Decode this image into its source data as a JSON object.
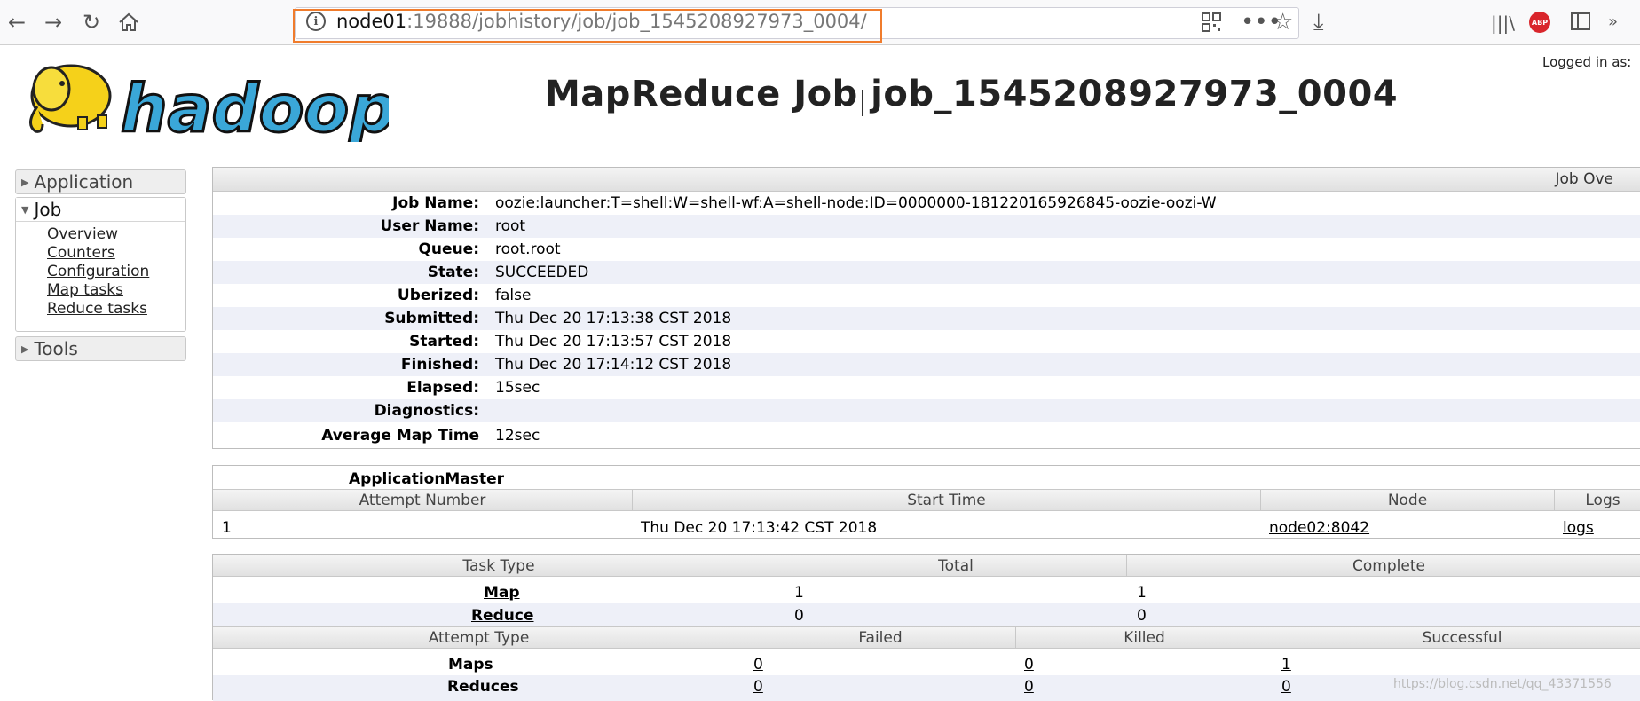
{
  "browser": {
    "url_host": "node01",
    "url_path": ":19888/jobhistory/job/job_1545208927973_0004/"
  },
  "header": {
    "logo_text": "hadoop",
    "title": "MapReduce Job job_1545208927973_0004",
    "logged_in": "Logged in as:"
  },
  "nav": {
    "application": "Application",
    "job": "Job",
    "job_links": [
      "Overview",
      "Counters",
      "Configuration",
      "Map tasks",
      "Reduce tasks"
    ],
    "tools": "Tools"
  },
  "overview": {
    "heading": "Job Ove",
    "rows": [
      {
        "label": "Job Name:",
        "value": "oozie:launcher:T=shell:W=shell-wf:A=shell-node:ID=0000000-181220165926845-oozie-oozi-W"
      },
      {
        "label": "User Name:",
        "value": "root"
      },
      {
        "label": "Queue:",
        "value": "root.root"
      },
      {
        "label": "State:",
        "value": "SUCCEEDED"
      },
      {
        "label": "Uberized:",
        "value": "false"
      },
      {
        "label": "Submitted:",
        "value": "Thu Dec 20 17:13:38 CST 2018"
      },
      {
        "label": "Started:",
        "value": "Thu Dec 20 17:13:57 CST 2018"
      },
      {
        "label": "Finished:",
        "value": "Thu Dec 20 17:14:12 CST 2018"
      },
      {
        "label": "Elapsed:",
        "value": "15sec"
      },
      {
        "label": "Diagnostics:",
        "value": ""
      },
      {
        "label": "Average Map Time",
        "value": "12sec"
      }
    ]
  },
  "app_master": {
    "title": "ApplicationMaster",
    "columns": [
      "Attempt Number",
      "Start Time",
      "Node",
      "Logs"
    ],
    "row": {
      "attempt": "1",
      "start_time": "Thu Dec 20 17:13:42 CST 2018",
      "node": "node02:8042",
      "logs": "logs"
    }
  },
  "tasks": {
    "columns": [
      "Task Type",
      "Total",
      "Complete"
    ],
    "rows": [
      {
        "type": "Map",
        "total": "1",
        "complete": "1"
      },
      {
        "type": "Reduce",
        "total": "0",
        "complete": "0"
      }
    ]
  },
  "attempts": {
    "columns": [
      "Attempt Type",
      "Failed",
      "Killed",
      "Successful"
    ],
    "rows": [
      {
        "type": "Maps",
        "failed": "0",
        "killed": "0",
        "successful": "1"
      },
      {
        "type": "Reduces",
        "failed": "0",
        "killed": "0",
        "successful": "0"
      }
    ]
  },
  "watermark": "https://blog.csdn.net/qq_43371556"
}
